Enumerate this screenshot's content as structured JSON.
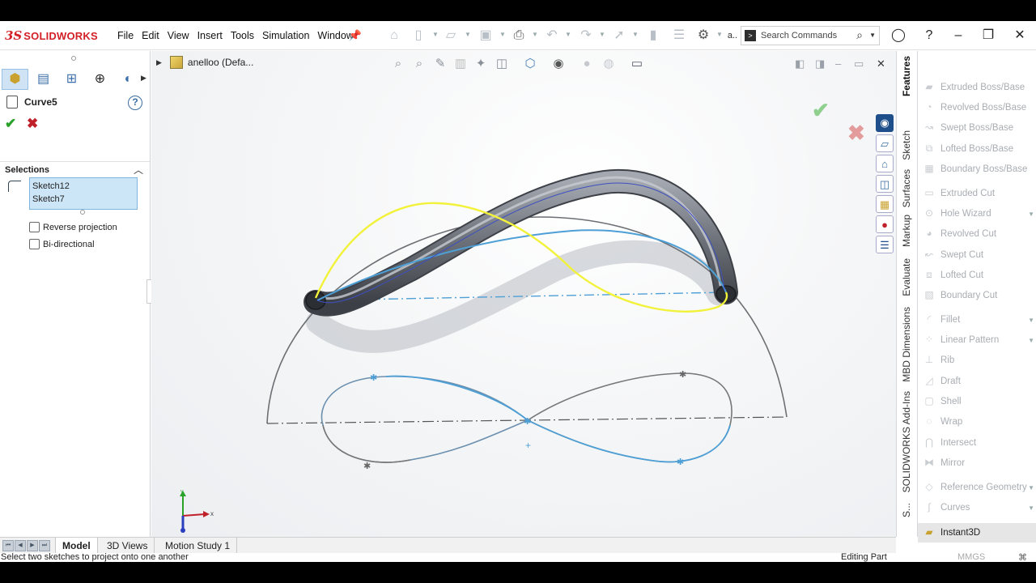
{
  "app": {
    "logo_ds": "3S",
    "logo_name": "SOLIDWORKS"
  },
  "menu": [
    "File",
    "Edit",
    "View",
    "Insert",
    "Tools",
    "Simulation",
    "Window"
  ],
  "toolbar": {
    "overflow_label": "a.."
  },
  "search": {
    "label": "Search Commands"
  },
  "document": {
    "title": "anelloo  (Defa..."
  },
  "property_manager": {
    "feature_name": "Curve5",
    "selections_header": "Selections",
    "selections": [
      "Sketch12",
      "Sketch7"
    ],
    "options": [
      {
        "label": "Reverse projection",
        "checked": false
      },
      {
        "label": "Bi-directional",
        "checked": false
      }
    ]
  },
  "triad": {
    "x_label": "x",
    "y_label": "y"
  },
  "command_tabs": [
    "Features",
    "Sketch",
    "Surfaces",
    "Markup",
    "Evaluate",
    "MBD Dimensions",
    "SOLIDWORKS Add-Ins",
    "S..."
  ],
  "commands": [
    {
      "label": "Extruded Boss/Base",
      "icon": "extrude-boss-icon"
    },
    {
      "label": "Revolved Boss/Base",
      "icon": "revolve-boss-icon"
    },
    {
      "label": "Swept Boss/Base",
      "icon": "sweep-boss-icon"
    },
    {
      "label": "Lofted Boss/Base",
      "icon": "loft-boss-icon"
    },
    {
      "label": "Boundary Boss/Base",
      "icon": "boundary-boss-icon"
    },
    {
      "label": "Extruded Cut",
      "icon": "extrude-cut-icon"
    },
    {
      "label": "Hole Wizard",
      "icon": "hole-wizard-icon"
    },
    {
      "label": "Revolved Cut",
      "icon": "revolve-cut-icon"
    },
    {
      "label": "Swept Cut",
      "icon": "sweep-cut-icon"
    },
    {
      "label": "Lofted Cut",
      "icon": "loft-cut-icon"
    },
    {
      "label": "Boundary Cut",
      "icon": "boundary-cut-icon"
    },
    {
      "label": "Fillet",
      "icon": "fillet-icon"
    },
    {
      "label": "Linear Pattern",
      "icon": "linear-pattern-icon"
    },
    {
      "label": "Rib",
      "icon": "rib-icon"
    },
    {
      "label": "Draft",
      "icon": "draft-icon"
    },
    {
      "label": "Shell",
      "icon": "shell-icon"
    },
    {
      "label": "Wrap",
      "icon": "wrap-icon"
    },
    {
      "label": "Intersect",
      "icon": "intersect-icon"
    },
    {
      "label": "Mirror",
      "icon": "mirror-icon"
    },
    {
      "label": "Reference Geometry",
      "icon": "reference-geometry-icon"
    },
    {
      "label": "Curves",
      "icon": "curves-icon"
    },
    {
      "label": "Instant3D",
      "icon": "instant3d-icon"
    }
  ],
  "bottom_tabs": [
    "Model",
    "3D Views",
    "Motion Study 1"
  ],
  "status": {
    "left": "Select two sketches to project onto one another",
    "mode": "Editing Part",
    "units": "MMGS"
  },
  "colors": {
    "accent_red": "#d31f26",
    "sketch_blue": "#4d9fd6",
    "sketch_yellow": "#f2f23a",
    "tube_gray": "#6b6f77"
  }
}
